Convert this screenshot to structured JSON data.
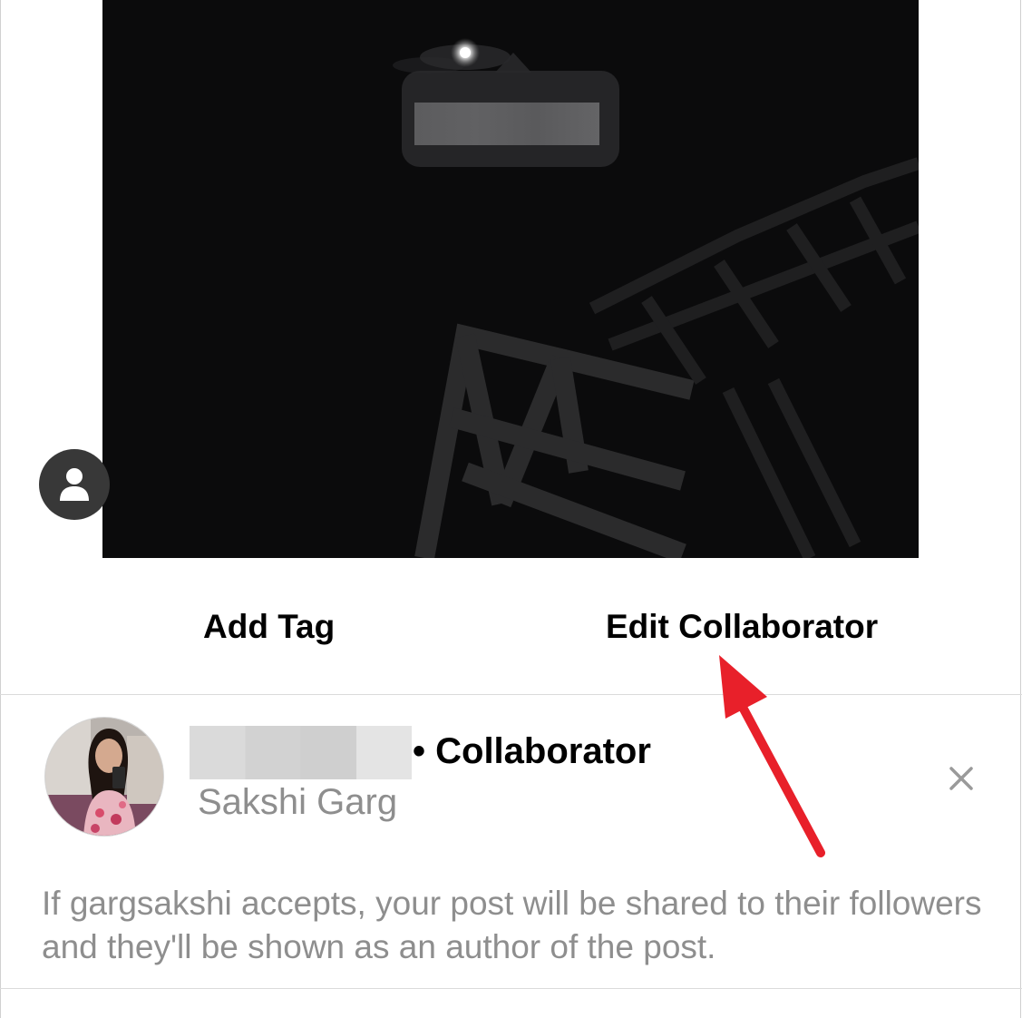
{
  "photo": {
    "description_icon": "night-sky-photo",
    "tag_bubble": {
      "redacted": true
    }
  },
  "tag_people": {
    "icon": "person-icon"
  },
  "tabs": {
    "add_tag": "Add Tag",
    "edit_collaborator": "Edit Collaborator"
  },
  "collaborator": {
    "username_redacted": true,
    "role": "• Collaborator",
    "full_name": "Sakshi Garg",
    "remove_icon": "close-icon"
  },
  "info": {
    "text": "If gargsakshi accepts, your post will be shared to their followers and they'll be shown as an author of the post."
  },
  "colors": {
    "annotation_arrow": "#e8202a",
    "secondary_text": "#8e8e8e",
    "divider": "#dbdbdb"
  }
}
